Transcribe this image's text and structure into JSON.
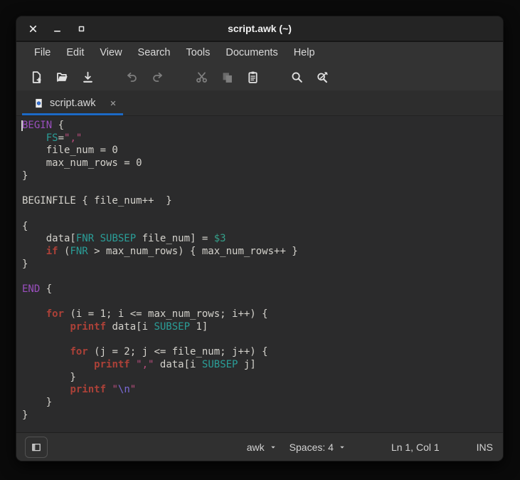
{
  "window": {
    "title": "script.awk (~)"
  },
  "titlebar": {
    "controls": [
      {
        "name": "close",
        "icon": "close-icon"
      },
      {
        "name": "minimize",
        "icon": "minimize-icon"
      },
      {
        "name": "maximize",
        "icon": "maximize-icon"
      }
    ]
  },
  "menubar": {
    "items": [
      "File",
      "Edit",
      "View",
      "Search",
      "Tools",
      "Documents",
      "Help"
    ]
  },
  "toolbar": {
    "buttons": [
      {
        "name": "new-document",
        "icon": "document-new-icon",
        "enabled": true,
        "group": 0
      },
      {
        "name": "open-document",
        "icon": "document-open-icon",
        "enabled": true,
        "group": 0
      },
      {
        "name": "save-document",
        "icon": "document-save-icon",
        "enabled": true,
        "group": 0
      },
      {
        "name": "undo",
        "icon": "undo-arrow-icon",
        "enabled": false,
        "group": 1
      },
      {
        "name": "redo",
        "icon": "redo-arrow-icon",
        "enabled": false,
        "group": 1
      },
      {
        "name": "cut",
        "icon": "scissors-icon",
        "enabled": false,
        "group": 2
      },
      {
        "name": "copy",
        "icon": "copy-pages-icon",
        "enabled": false,
        "group": 2
      },
      {
        "name": "paste",
        "icon": "clipboard-icon",
        "enabled": true,
        "group": 2
      },
      {
        "name": "find",
        "icon": "magnifier-icon",
        "enabled": true,
        "group": 3
      },
      {
        "name": "find-replace",
        "icon": "magnifier-replace-icon",
        "enabled": true,
        "group": 3
      }
    ]
  },
  "tabbar": {
    "tabs": [
      {
        "label": "script.awk",
        "icon": "text-document-icon",
        "active": true
      }
    ]
  },
  "editor": {
    "lines": [
      [
        [
          "kw",
          "BEGIN"
        ],
        [
          "def",
          " {"
        ]
      ],
      [
        [
          "def",
          "    "
        ],
        [
          "bi",
          "FS"
        ],
        [
          "def",
          "="
        ],
        [
          "str",
          "\",\""
        ]
      ],
      [
        [
          "def",
          "    file_num = 0"
        ]
      ],
      [
        [
          "def",
          "    max_num_rows = 0"
        ]
      ],
      [
        [
          "def",
          "}"
        ]
      ],
      [],
      [
        [
          "def",
          "BEGINFILE { file_num++  }"
        ]
      ],
      [],
      [
        [
          "def",
          "{"
        ]
      ],
      [
        [
          "def",
          "    data["
        ],
        [
          "bi",
          "FNR"
        ],
        [
          "def",
          " "
        ],
        [
          "bi",
          "SUBSEP"
        ],
        [
          "def",
          " file_num] = "
        ],
        [
          "fld",
          "$3"
        ]
      ],
      [
        [
          "def",
          "    "
        ],
        [
          "ctrl",
          "if"
        ],
        [
          "def",
          " ("
        ],
        [
          "bi",
          "FNR"
        ],
        [
          "def",
          " > max_num_rows) { max_num_rows++ }"
        ]
      ],
      [
        [
          "def",
          "}"
        ]
      ],
      [],
      [
        [
          "kw",
          "END"
        ],
        [
          "def",
          " {"
        ]
      ],
      [],
      [
        [
          "def",
          "    "
        ],
        [
          "ctrl",
          "for"
        ],
        [
          "def",
          " (i = 1; i <= max_num_rows; i++) {"
        ]
      ],
      [
        [
          "def",
          "        "
        ],
        [
          "ctrl",
          "printf"
        ],
        [
          "def",
          " data[i "
        ],
        [
          "bi",
          "SUBSEP"
        ],
        [
          "def",
          " 1]"
        ]
      ],
      [],
      [
        [
          "def",
          "        "
        ],
        [
          "ctrl",
          "for"
        ],
        [
          "def",
          " (j = 2; j <= file_num; j++) {"
        ]
      ],
      [
        [
          "def",
          "            "
        ],
        [
          "ctrl",
          "printf"
        ],
        [
          "def",
          " "
        ],
        [
          "str",
          "\",\""
        ],
        [
          "def",
          " data[i "
        ],
        [
          "bi",
          "SUBSEP"
        ],
        [
          "def",
          " j]"
        ]
      ],
      [
        [
          "def",
          "        }"
        ]
      ],
      [
        [
          "def",
          "        "
        ],
        [
          "ctrl",
          "printf"
        ],
        [
          "def",
          " "
        ],
        [
          "str",
          "\""
        ],
        [
          "esc",
          "\\n"
        ],
        [
          "str",
          "\""
        ]
      ],
      [
        [
          "def",
          "    }"
        ]
      ],
      [
        [
          "def",
          "}"
        ]
      ]
    ],
    "cursor": {
      "line": 1,
      "col": 1
    }
  },
  "statusbar": {
    "language": "awk",
    "tab_width": "Spaces: 4",
    "cursor_position": "Ln 1, Col 1",
    "input_mode": "INS"
  },
  "colors": {
    "accent_blue": "#1c6ac6",
    "editor_background": "#2b2b2c",
    "editor_text": "#d4d2cc",
    "syntax_keyword_purple": "#9a4fbe",
    "syntax_control_red": "#ac4138",
    "syntax_builtin_teal": "#2a9e98",
    "syntax_field_teal": "#35a08a",
    "syntax_string_pink": "#b94d7d",
    "syntax_escape_violet": "#7a6ad6"
  }
}
